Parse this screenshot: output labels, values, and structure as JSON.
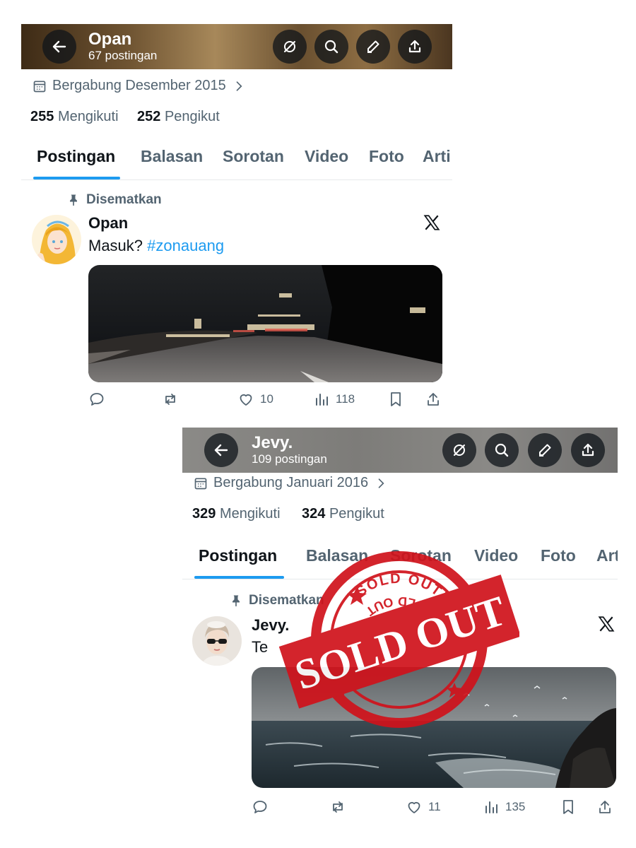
{
  "profiles": [
    {
      "name": "Opan",
      "post_count": "67 postingan",
      "joined": "Bergabung Desember 2015",
      "following_count": "255",
      "following_label": "Mengikuti",
      "followers_count": "252",
      "followers_label": "Pengikut",
      "tabs": [
        "Postingan",
        "Balasan",
        "Sorotan",
        "Video",
        "Foto",
        "Arti"
      ],
      "pinned_label": "Disematkan",
      "post": {
        "author": "Opan",
        "text": "Masuk?",
        "hashtag": "#zonauang",
        "likes": "10",
        "views": "118"
      }
    },
    {
      "name": "Jevy.",
      "post_count": "109 postingan",
      "joined": "Bergabung Januari 2016",
      "following_count": "329",
      "following_label": "Mengikuti",
      "followers_count": "324",
      "followers_label": "Pengikut",
      "tabs": [
        "Postingan",
        "Balasan",
        "Sorotan",
        "Video",
        "Foto",
        "Art"
      ],
      "pinned_label": "Disematkan",
      "post": {
        "author": "Jevy.",
        "text": "Te",
        "likes": "11",
        "views": "135"
      }
    }
  ],
  "stamp": {
    "big_text": "SOLD OUT",
    "ring_text": "SOLD OUT",
    "color": "#d0121b"
  },
  "colors": {
    "accent": "#1d9bf0",
    "muted": "#536471",
    "text": "#0f1419"
  }
}
